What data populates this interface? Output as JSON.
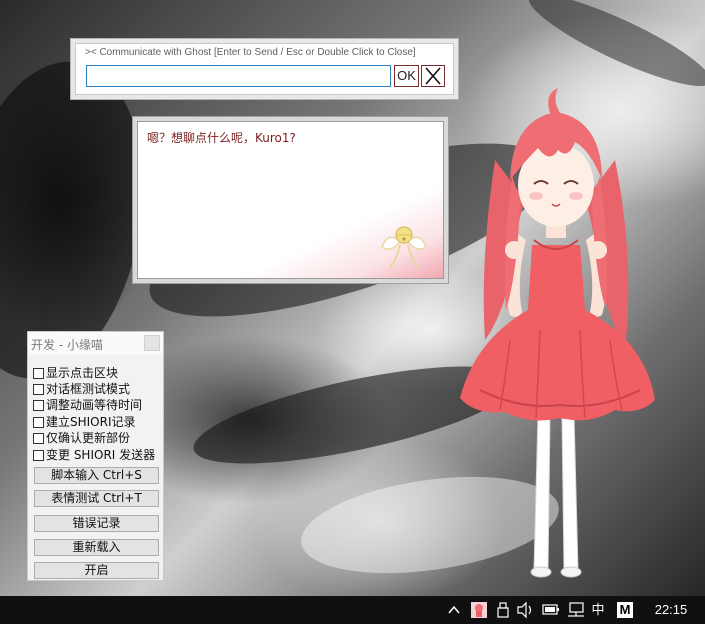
{
  "communicate": {
    "title": "><  Communicate with Ghost   [Enter to Send / Esc or Double Click to Close]",
    "input_value": "",
    "ok_label": "OK"
  },
  "balloon": {
    "text": "嗯？想聊点什么呢，Kuro1?"
  },
  "dev_panel": {
    "title": "开发 - 小缘喵",
    "checkboxes": [
      {
        "label": "显示点击区块",
        "checked": false
      },
      {
        "label": "对话框测试模式",
        "checked": false
      },
      {
        "label": "调整动画等待时间",
        "checked": false
      },
      {
        "label": "建立SHIORI记录",
        "checked": false
      },
      {
        "label": "仅确认更新部份",
        "checked": false
      },
      {
        "label": "变更 SHIORI 发送器",
        "checked": false
      }
    ],
    "buttons": [
      {
        "label": "脚本输入 Ctrl+S"
      },
      {
        "label": "表情测试 Ctrl+T"
      },
      {
        "label": "错误记录"
      },
      {
        "label": "重新载入"
      },
      {
        "label": "开启"
      }
    ]
  },
  "taskbar": {
    "ime_label": "中",
    "ime_mode": "M",
    "clock": "22:15",
    "tray_icons": [
      "chevron-up-icon",
      "ghost-tray-icon",
      "usb-icon",
      "volume-icon",
      "battery-icon",
      "network-icon"
    ]
  },
  "colors": {
    "balloon_text": "#7a1f1f",
    "input_border": "#2f84c6",
    "taskbar": "#101010",
    "dress": "#ef5f64",
    "hair": "#ee6e74"
  }
}
